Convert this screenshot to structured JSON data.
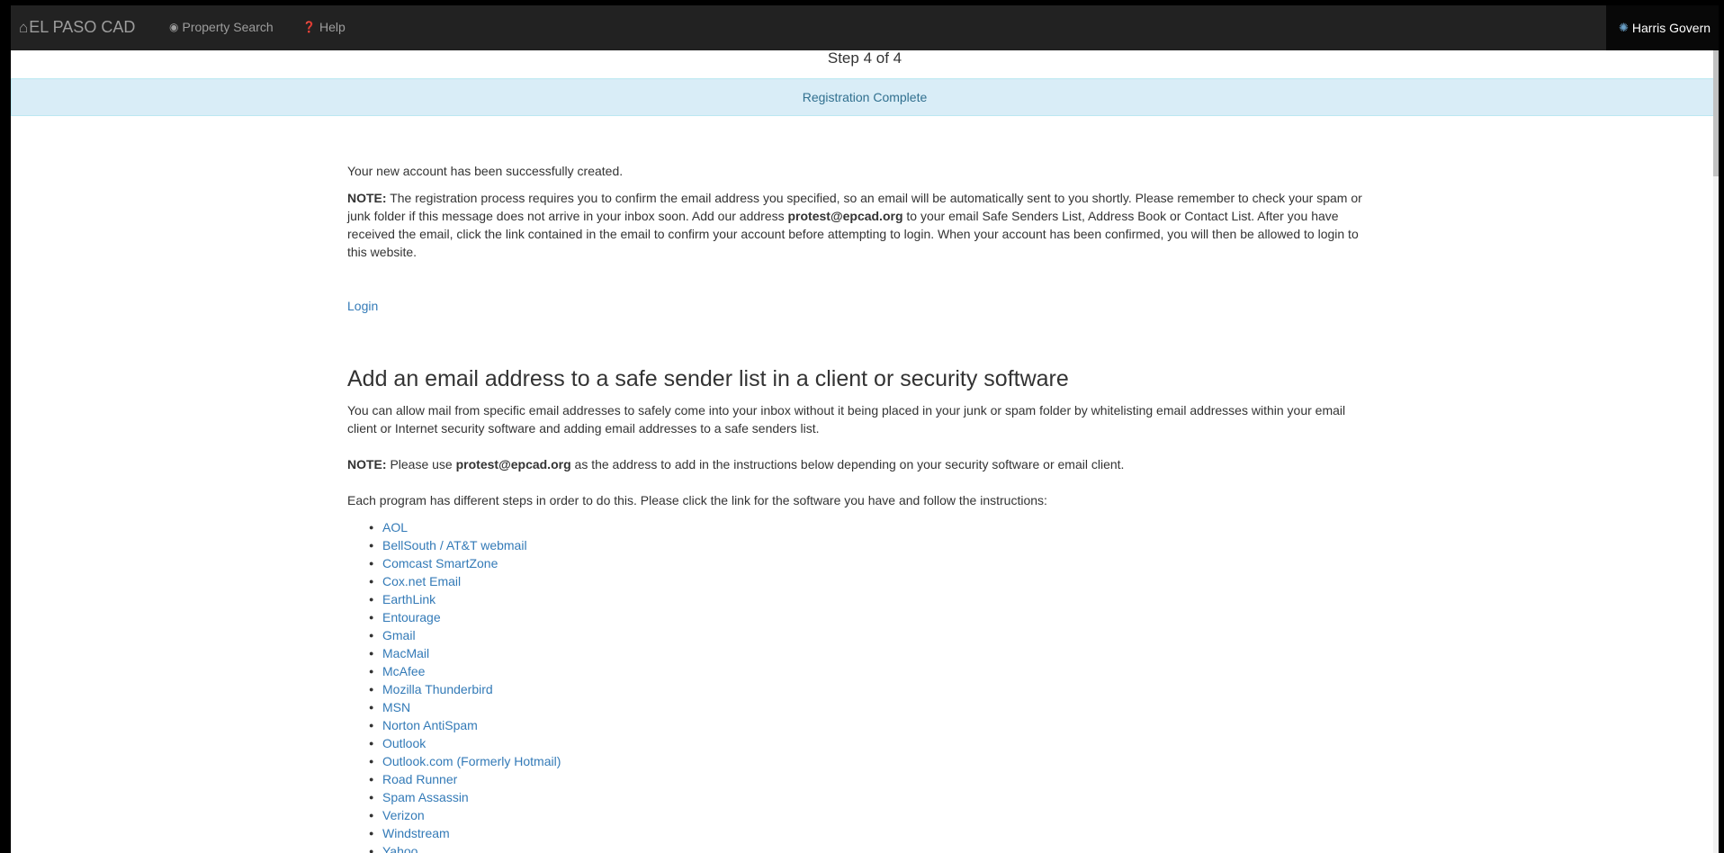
{
  "navbar": {
    "brand": "EL PASO CAD",
    "property_search": "Property Search",
    "help": "Help",
    "user": "Harris Govern"
  },
  "step": "Step 4 of 4",
  "alert": "Registration Complete",
  "main": {
    "created": "Your new account has been successfully created.",
    "note1_label": "NOTE:",
    "note1_text_a": " The registration process requires you to confirm the email address you specified, so an email will be automatically sent to you shortly. Please remember to check your spam or junk folder if this message does not arrive in your inbox soon. Add our address ",
    "note1_email": "protest@epcad.org",
    "note1_text_b": " to your email Safe Senders List, Address Book or Contact List. After you have received the email, click the link contained in the email to confirm your account before attempting to login. When your account has been confirmed, you will then be allowed to login to this website.",
    "login": "Login",
    "heading": "Add an email address to a safe sender list in a client or security software",
    "intro": "You can allow mail from specific email addresses to safely come into your inbox without it being placed in your junk or spam folder by whitelisting email addresses within your email client or Internet security software and adding email addresses to a safe senders list.",
    "note2_label": "NOTE:",
    "note2_text_a": " Please use ",
    "note2_email": "protest@epcad.org",
    "note2_text_b": " as the address to add in the instructions below depending on your security software or email client.",
    "each_program": "Each program has different steps in order to do this. Please click the link for the software you have and follow the instructions:",
    "programs": [
      "AOL",
      "BellSouth / AT&T webmail",
      "Comcast SmartZone",
      "Cox.net Email",
      "EarthLink",
      "Entourage",
      "Gmail",
      "MacMail",
      "McAfee",
      "Mozilla Thunderbird",
      "MSN",
      "Norton AntiSpam",
      "Outlook",
      "Outlook.com (Formerly Hotmail)",
      "Road Runner",
      "Spam Assassin",
      "Verizon",
      "Windstream",
      "Yahoo"
    ]
  },
  "icons": {
    "home": "home-icon",
    "globe": "globe-icon",
    "question": "question-circle-icon",
    "user": "user-icon"
  },
  "colors": {
    "navbar_bg": "#222222",
    "link": "#337ab7",
    "alert_bg": "#d9edf7",
    "alert_text": "#31708f"
  }
}
